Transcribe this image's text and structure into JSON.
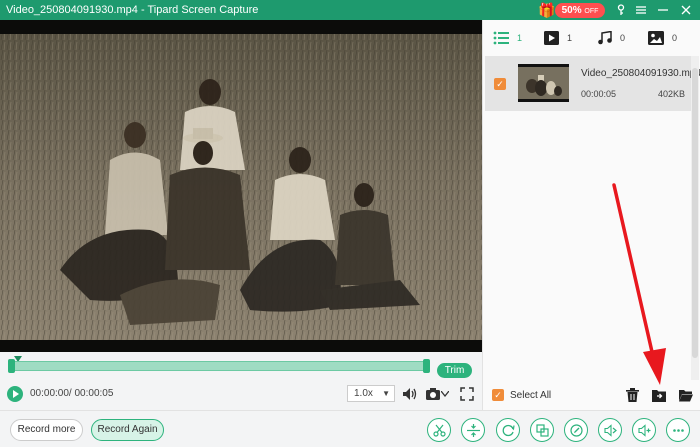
{
  "window": {
    "title": "Video_250804091930.mp4  -  Tipard Screen Capture",
    "promo_label": "50%",
    "promo_suffix": "OFF"
  },
  "player": {
    "trim_label": "Trim",
    "time": "00:00:00/ 00:00:05",
    "speed": "1.0x"
  },
  "right_panel": {
    "tabs": [
      {
        "icon": "list-icon",
        "count": "1"
      },
      {
        "icon": "video-icon",
        "count": "1"
      },
      {
        "icon": "music-icon",
        "count": "0"
      },
      {
        "icon": "image-icon",
        "count": "0"
      }
    ],
    "items": [
      {
        "name": "Video_250804091930.mp4",
        "duration": "00:00:05",
        "size": "402KB"
      }
    ],
    "select_all_label": "Select All"
  },
  "bottom_bar": {
    "record_more_label": "Record more",
    "record_again_label": "Record Again",
    "tools": [
      "scissors-icon",
      "split-icon",
      "rotate-icon",
      "merge-icon",
      "edit-icon",
      "audio-out-icon",
      "audio-in-icon",
      "more-icon"
    ]
  },
  "colors": {
    "accent": "#2db37d",
    "titlebar": "#1e9a6e",
    "checkbox": "#f08c3a",
    "annotation_arrow": "#e8181e"
  }
}
